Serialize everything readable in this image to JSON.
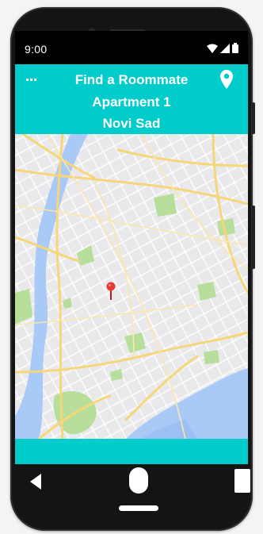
{
  "status_bar": {
    "time": "9:00"
  },
  "app_bar": {
    "title": "Find a Roommate",
    "apartment_name": "Apartment 1",
    "city": "Novi Sad"
  },
  "icons": {
    "menu": "more-horiz-icon",
    "location": "location-pin-icon",
    "map_marker": "map-marker-icon",
    "wifi": "wifi-icon",
    "signal": "signal-icon",
    "battery": "battery-icon",
    "back": "back-icon",
    "home": "home-icon",
    "recents": "recents-icon"
  },
  "colors": {
    "accent": "#00CCCC",
    "marker": "#E53935",
    "water": "#A9C9F7",
    "park": "#B7DE9A",
    "road_major": "#F6D67A"
  }
}
